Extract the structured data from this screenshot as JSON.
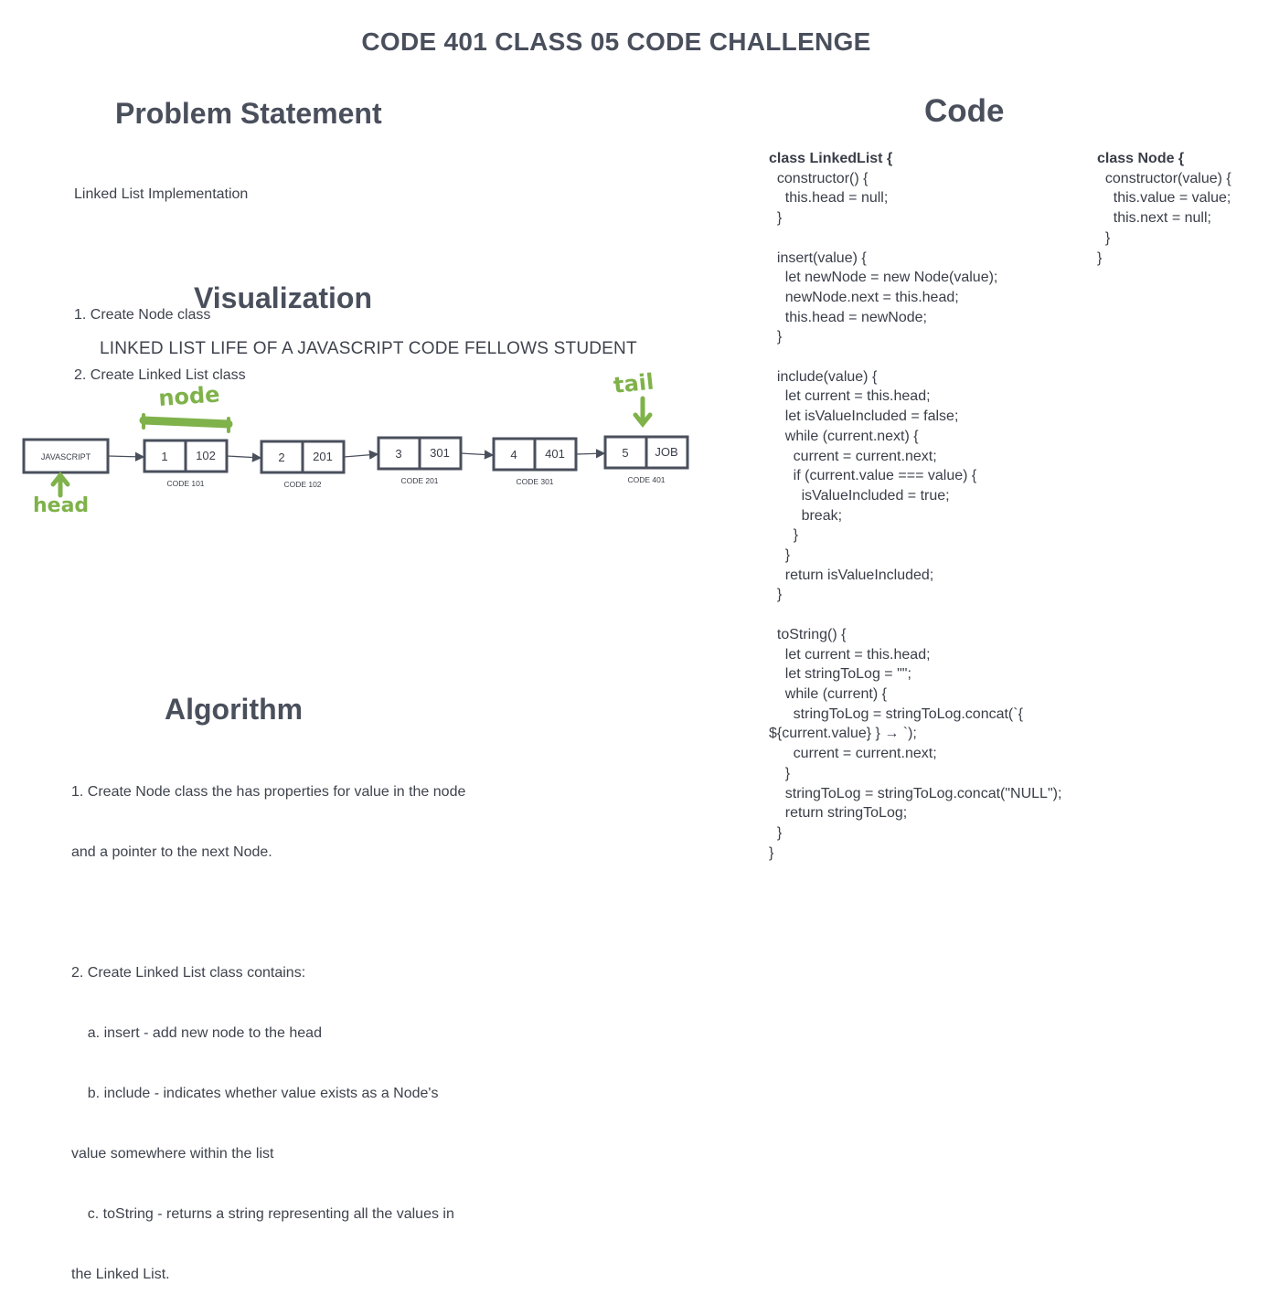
{
  "title": "CODE 401 CLASS 05 CODE CHALLENGE",
  "problem": {
    "heading": "Problem Statement",
    "lines": [
      "Linked List Implementation",
      "",
      "1. Create Node class",
      "2. Create Linked List class"
    ]
  },
  "visualization": {
    "heading": "Visualization",
    "subtitle": "LINKED LIST LIFE OF A JAVASCRIPT CODE FELLOWS STUDENT",
    "head_box": "JAVASCRIPT",
    "nodes": [
      {
        "value": "1",
        "next": "102",
        "label": "CODE 101"
      },
      {
        "value": "2",
        "next": "201",
        "label": "CODE 102"
      },
      {
        "value": "3",
        "next": "301",
        "label": "CODE 201"
      },
      {
        "value": "4",
        "next": "401",
        "label": "CODE 301"
      },
      {
        "value": "5",
        "next": "JOB",
        "label": "CODE 401"
      }
    ],
    "annotations": {
      "node": "node",
      "head": "head",
      "tail": "tail"
    },
    "annotation_color": "#7fb24a"
  },
  "algorithm": {
    "heading": "Algorithm",
    "lines": [
      "1. Create Node class the has properties for value in the node",
      "and a pointer to the next Node.",
      "",
      "2. Create Linked List class contains:",
      "    a. insert - add new node to the head",
      "    b. include - indicates whether value exists as a Node's",
      "value somewhere within the list",
      "    c. toString - returns a string representing all the values in",
      "the Linked List."
    ]
  },
  "code": {
    "heading": "Code",
    "linked_list": [
      "class LinkedList {",
      "  constructor() {",
      "    this.head = null;",
      "  }",
      "",
      "  insert(value) {",
      "    let newNode = new Node(value);",
      "    newNode.next = this.head;",
      "    this.head = newNode;",
      "  }",
      "",
      "  include(value) {",
      "    let current = this.head;",
      "    let isValueIncluded = false;",
      "    while (current.next) {",
      "      current = current.next;",
      "      if (current.value === value) {",
      "        isValueIncluded = true;",
      "        break;",
      "      }",
      "    }",
      "    return isValueIncluded;",
      "  }",
      "",
      "  toString() {",
      "    let current = this.head;",
      "    let stringToLog = \"\";",
      "    while (current) {",
      "      stringToLog = stringToLog.concat(`{",
      "${current.value} } → `);",
      "      current = current.next;",
      "    }",
      "    stringToLog = stringToLog.concat(\"NULL\");",
      "    return stringToLog;",
      "  }",
      "}"
    ],
    "node_class": [
      "class Node {",
      "  constructor(value) {",
      "    this.value = value;",
      "    this.next = null;",
      "  }",
      "}"
    ]
  }
}
